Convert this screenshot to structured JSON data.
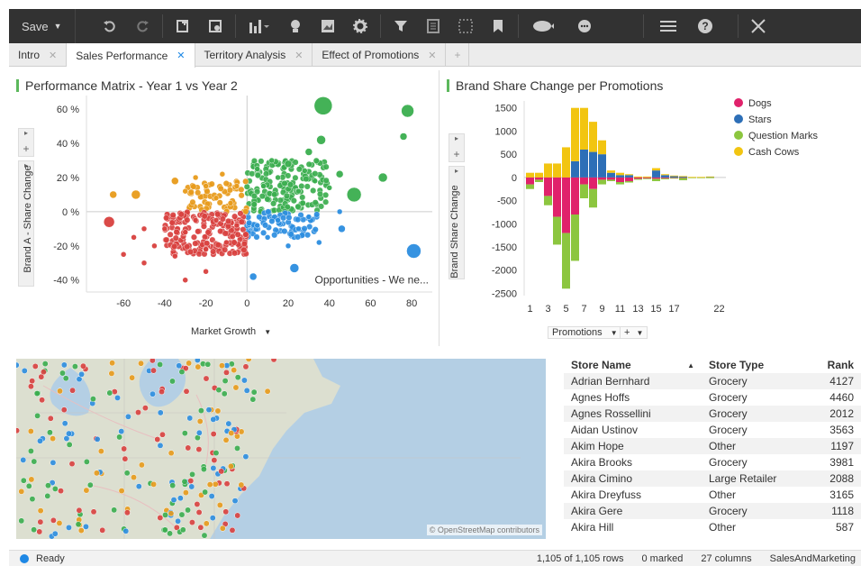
{
  "toolbar": {
    "save_label": "Save",
    "icons": [
      "undo-icon",
      "redo-icon",
      "new-page-icon",
      "page-settings-icon",
      "bar-chart-icon",
      "lightbulb-icon",
      "image-icon",
      "gear-icon",
      "filter-icon",
      "details-icon",
      "select-icon",
      "bookmark-icon",
      "collaboration-icon",
      "chat-icon",
      "menu-icon",
      "help-icon",
      "close-icon"
    ]
  },
  "tabs": [
    {
      "label": "Intro",
      "active": false
    },
    {
      "label": "Sales Performance",
      "active": true
    },
    {
      "label": "Territory Analysis",
      "active": false
    },
    {
      "label": "Effect of Promotions",
      "active": false
    }
  ],
  "matrix": {
    "title": "Performance Matrix - Year 1 vs Year 2",
    "xlabel": "Market Growth",
    "ylabel": "Brand A - Share Change",
    "annotation": "Opportunities - We ne...",
    "colors": {
      "red": "#d9413f",
      "orange": "#e89b1b",
      "green": "#3bae4f",
      "blue": "#2c8ee0"
    }
  },
  "brand": {
    "title": "Brand Share Change per Promotions",
    "xlabel": "Promotions",
    "ylabel": "Brand Share Change"
  },
  "chart_data": [
    {
      "type": "scatter",
      "title": "Performance Matrix - Year 1 vs Year 2",
      "xlabel": "Market Growth",
      "ylabel": "Brand A - Share Change",
      "xlim": [
        -78,
        90
      ],
      "ylim": [
        -47,
        68
      ],
      "x_ticks": [
        -60,
        -40,
        -20,
        0,
        20,
        40,
        60,
        80
      ],
      "y_ticks": [
        60,
        40,
        20,
        0,
        -20,
        -40
      ],
      "y_tick_labels": [
        "60 %",
        "40 %",
        "20 %",
        "0 %",
        "-20 %",
        "-40 %"
      ],
      "series": [
        {
          "color": "#3bae4f",
          "points": [
            [
              37,
              62,
              10
            ],
            [
              78,
              59,
              7
            ],
            [
              76,
              44,
              4
            ],
            [
              36,
              42,
              5
            ],
            [
              52,
              10,
              8
            ],
            [
              66,
              20,
              5
            ],
            [
              45,
              22,
              4
            ],
            [
              30,
              35,
              4
            ],
            [
              20,
              28,
              4
            ],
            [
              12,
              30,
              3
            ],
            [
              8,
              15,
              3
            ],
            [
              25,
              12,
              3
            ],
            [
              40,
              14,
              3
            ],
            [
              15,
              20,
              3
            ],
            [
              5,
              25,
              3
            ],
            [
              28,
              24,
              3
            ],
            [
              33,
              18,
              3
            ]
          ]
        },
        {
          "color": "#2c8ee0",
          "points": [
            [
              81,
              -23,
              8
            ],
            [
              23,
              -33,
              5
            ],
            [
              3,
              -38,
              4
            ],
            [
              46,
              -10,
              4
            ],
            [
              35,
              -18,
              3
            ],
            [
              20,
              -20,
              3
            ],
            [
              10,
              -15,
              3
            ],
            [
              5,
              -8,
              3
            ],
            [
              15,
              -5,
              3
            ],
            [
              30,
              -3,
              3
            ],
            [
              45,
              0,
              3
            ],
            [
              25,
              -10,
              3
            ]
          ]
        },
        {
          "color": "#e89b1b",
          "points": [
            [
              -54,
              10,
              5
            ],
            [
              -65,
              10,
              4
            ],
            [
              -35,
              18,
              4
            ],
            [
              -25,
              20,
              3
            ],
            [
              -12,
              22,
              3
            ],
            [
              -20,
              15,
              3
            ],
            [
              -5,
              15,
              3
            ],
            [
              -15,
              8,
              3
            ],
            [
              -8,
              5,
              3
            ],
            [
              -30,
              12,
              3
            ]
          ]
        },
        {
          "color": "#d9413f",
          "points": [
            [
              -67,
              -6,
              6
            ],
            [
              -35,
              -26,
              3
            ],
            [
              -60,
              -25,
              3
            ],
            [
              -55,
              -15,
              3
            ],
            [
              -50,
              -30,
              3
            ],
            [
              -45,
              -20,
              3
            ],
            [
              -30,
              -12,
              3
            ],
            [
              -20,
              -22,
              3
            ],
            [
              -10,
              -18,
              3
            ],
            [
              -5,
              -8,
              3
            ],
            [
              -15,
              -5,
              3
            ],
            [
              -25,
              -5,
              3
            ],
            [
              -40,
              -10,
              3
            ],
            [
              -30,
              -40,
              3
            ],
            [
              -20,
              -35,
              3
            ],
            [
              -50,
              -10,
              3
            ]
          ]
        }
      ]
    },
    {
      "type": "bar",
      "stacked": true,
      "title": "Brand Share Change per Promotions",
      "xlabel": "Promotions",
      "ylabel": "Brand Share Change",
      "ylim": [
        -2550,
        1650
      ],
      "y_ticks": [
        1500,
        1000,
        500,
        0,
        -500,
        -1000,
        -1500,
        -2000,
        -2500
      ],
      "x_tick_labels": [
        "1",
        "3",
        "5",
        "7",
        "9",
        "11",
        "13",
        "15",
        "17",
        "22"
      ],
      "categories": [
        "1",
        "2",
        "3",
        "4",
        "5",
        "6",
        "7",
        "8",
        "9",
        "10",
        "11",
        "12",
        "13",
        "14",
        "15",
        "16",
        "17",
        "18",
        "19",
        "20",
        "21",
        "22"
      ],
      "legend_position": "top-right",
      "series": [
        {
          "name": "Dogs",
          "color": "#e0226b",
          "values": [
            -150,
            -50,
            -400,
            -850,
            -1200,
            -800,
            -150,
            -250,
            -50,
            -50,
            -100,
            -80,
            -30,
            -20,
            -30,
            -20,
            -10,
            -10,
            0,
            0,
            0,
            0
          ]
        },
        {
          "name": "Stars",
          "color": "#2d6fb7",
          "values": [
            0,
            0,
            0,
            0,
            0,
            350,
            600,
            550,
            500,
            100,
            50,
            50,
            0,
            0,
            150,
            50,
            30,
            20,
            0,
            0,
            10,
            0
          ]
        },
        {
          "name": "Question Marks",
          "color": "#8cc63f",
          "values": [
            -100,
            -50,
            -200,
            -600,
            -1200,
            -1000,
            -300,
            -400,
            -100,
            -30,
            -50,
            -30,
            -20,
            -10,
            -50,
            -20,
            -10,
            -50,
            -10,
            -5,
            -5,
            0
          ]
        },
        {
          "name": "Cash Cows",
          "color": "#f2c511",
          "values": [
            100,
            100,
            300,
            300,
            650,
            1150,
            900,
            650,
            300,
            50,
            50,
            20,
            20,
            20,
            50,
            20,
            10,
            10,
            10,
            10,
            10,
            0
          ]
        }
      ]
    }
  ],
  "map_attribution": "© OpenStreetMap contributors",
  "table": {
    "columns": [
      "Store Name",
      "Store Type",
      "Rank"
    ],
    "rows": [
      [
        "Adrian Bernhard",
        "Grocery",
        "4127"
      ],
      [
        "Agnes Hoffs",
        "Grocery",
        "4460"
      ],
      [
        "Agnes Rossellini",
        "Grocery",
        "2012"
      ],
      [
        "Aidan Ustinov",
        "Grocery",
        "3563"
      ],
      [
        "Akim Hope",
        "Other",
        "1197"
      ],
      [
        "Akira Brooks",
        "Grocery",
        "3981"
      ],
      [
        "Akira Cimino",
        "Large Retailer",
        "2088"
      ],
      [
        "Akira Dreyfuss",
        "Other",
        "3165"
      ],
      [
        "Akira Gere",
        "Grocery",
        "1118"
      ],
      [
        "Akira Hill",
        "Other",
        "587"
      ]
    ]
  },
  "status": {
    "state": "Ready",
    "rows": "1,105 of 1,105 rows",
    "marked": "0 marked",
    "columns": "27 columns",
    "source": "SalesAndMarketing"
  }
}
